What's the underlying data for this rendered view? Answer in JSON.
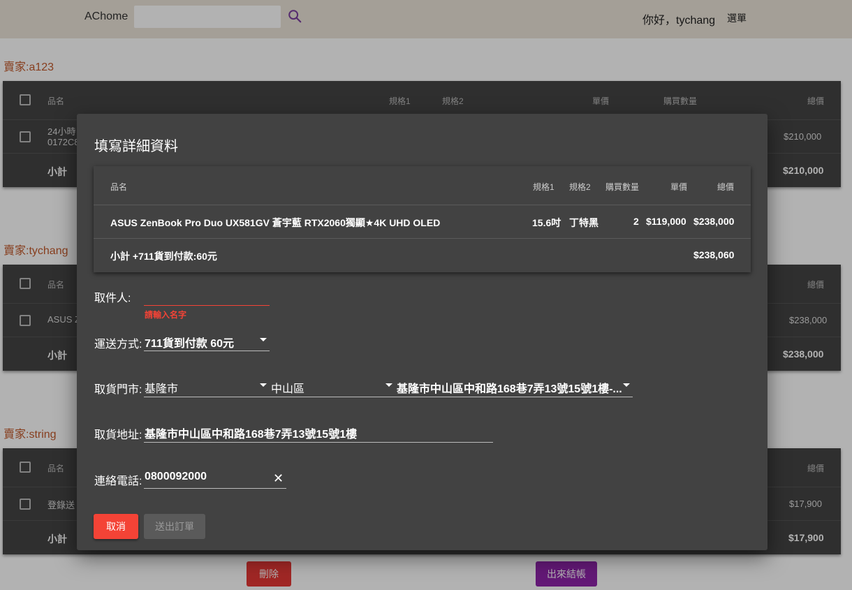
{
  "header": {
    "brand": "AChome",
    "search_placeholder": "",
    "greeting": "你好，tychang",
    "menu_label": "選單"
  },
  "cart_groups": [
    {
      "seller": "賣家:a123",
      "headers": {
        "name": "品名",
        "spec1": "規格1",
        "spec2": "規格2",
        "price": "單價",
        "qty": "購買數量",
        "total": "總價"
      },
      "item_name_line1": "24小時",
      "item_name_line2": "0172C8",
      "item_total": "$210,000",
      "subtotal_label": "小計",
      "subtotal": "$210,000"
    },
    {
      "seller": "賣家:tychang",
      "headers": {
        "name": "品名",
        "total": "總價"
      },
      "item_name_line1": "ASUS Z",
      "item_total": "$238,000",
      "subtotal_label": "小計",
      "subtotal": "$238,000"
    },
    {
      "seller": "賣家:string",
      "headers": {
        "name": "品名",
        "total": "總價"
      },
      "item_name_line1": "登錄送",
      "item_total": "$17,900",
      "subtotal_label": "小計",
      "subtotal": "$17,900"
    }
  ],
  "page_buttons": {
    "delete": "刪除",
    "checkout": "出來結帳"
  },
  "dialog": {
    "title": "填寫詳細資料",
    "table": {
      "headers": {
        "name": "品名",
        "spec1": "規格1",
        "spec2": "規格2",
        "qty": "購買數量",
        "price": "單價",
        "total": "總價"
      },
      "row": {
        "name": "ASUS ZenBook Pro Duo UX581GV 蒼宇藍 RTX2060獨顯★4K UHD OLED",
        "spec1": "15.6吋",
        "spec2": "丁特黑",
        "qty": "2",
        "price": "$119,000",
        "total": "$238,000"
      },
      "subtotal_label": "小計 +711貨到付款:60元",
      "subtotal": "$238,060"
    },
    "form": {
      "recipient_label": "取件人:",
      "recipient_value": "",
      "recipient_error": "請輸入名字",
      "shipping_label": "運送方式:",
      "shipping_value": "711貨到付款 60元",
      "store_label": "取貨門市:",
      "city_value": "基隆市",
      "district_value": "中山區",
      "store_value": "基隆市中山區中和路168巷7弄13號15號1樓-...",
      "address_label": "取貨地址:",
      "address_value": "基隆市中山區中和路168巷7弄13號15號1樓",
      "phone_label": "連絡電話:",
      "phone_value": "0800092000"
    },
    "buttons": {
      "cancel": "取消",
      "submit": "送出訂單"
    }
  },
  "colors": {
    "topbar": "#ebe4d8",
    "seller_text": "#c25a2c",
    "table_bg": "#444444",
    "dialog_bg": "#424242",
    "cancel": "#f44336",
    "delete": "#e53935",
    "checkout": "#8e24aa"
  }
}
